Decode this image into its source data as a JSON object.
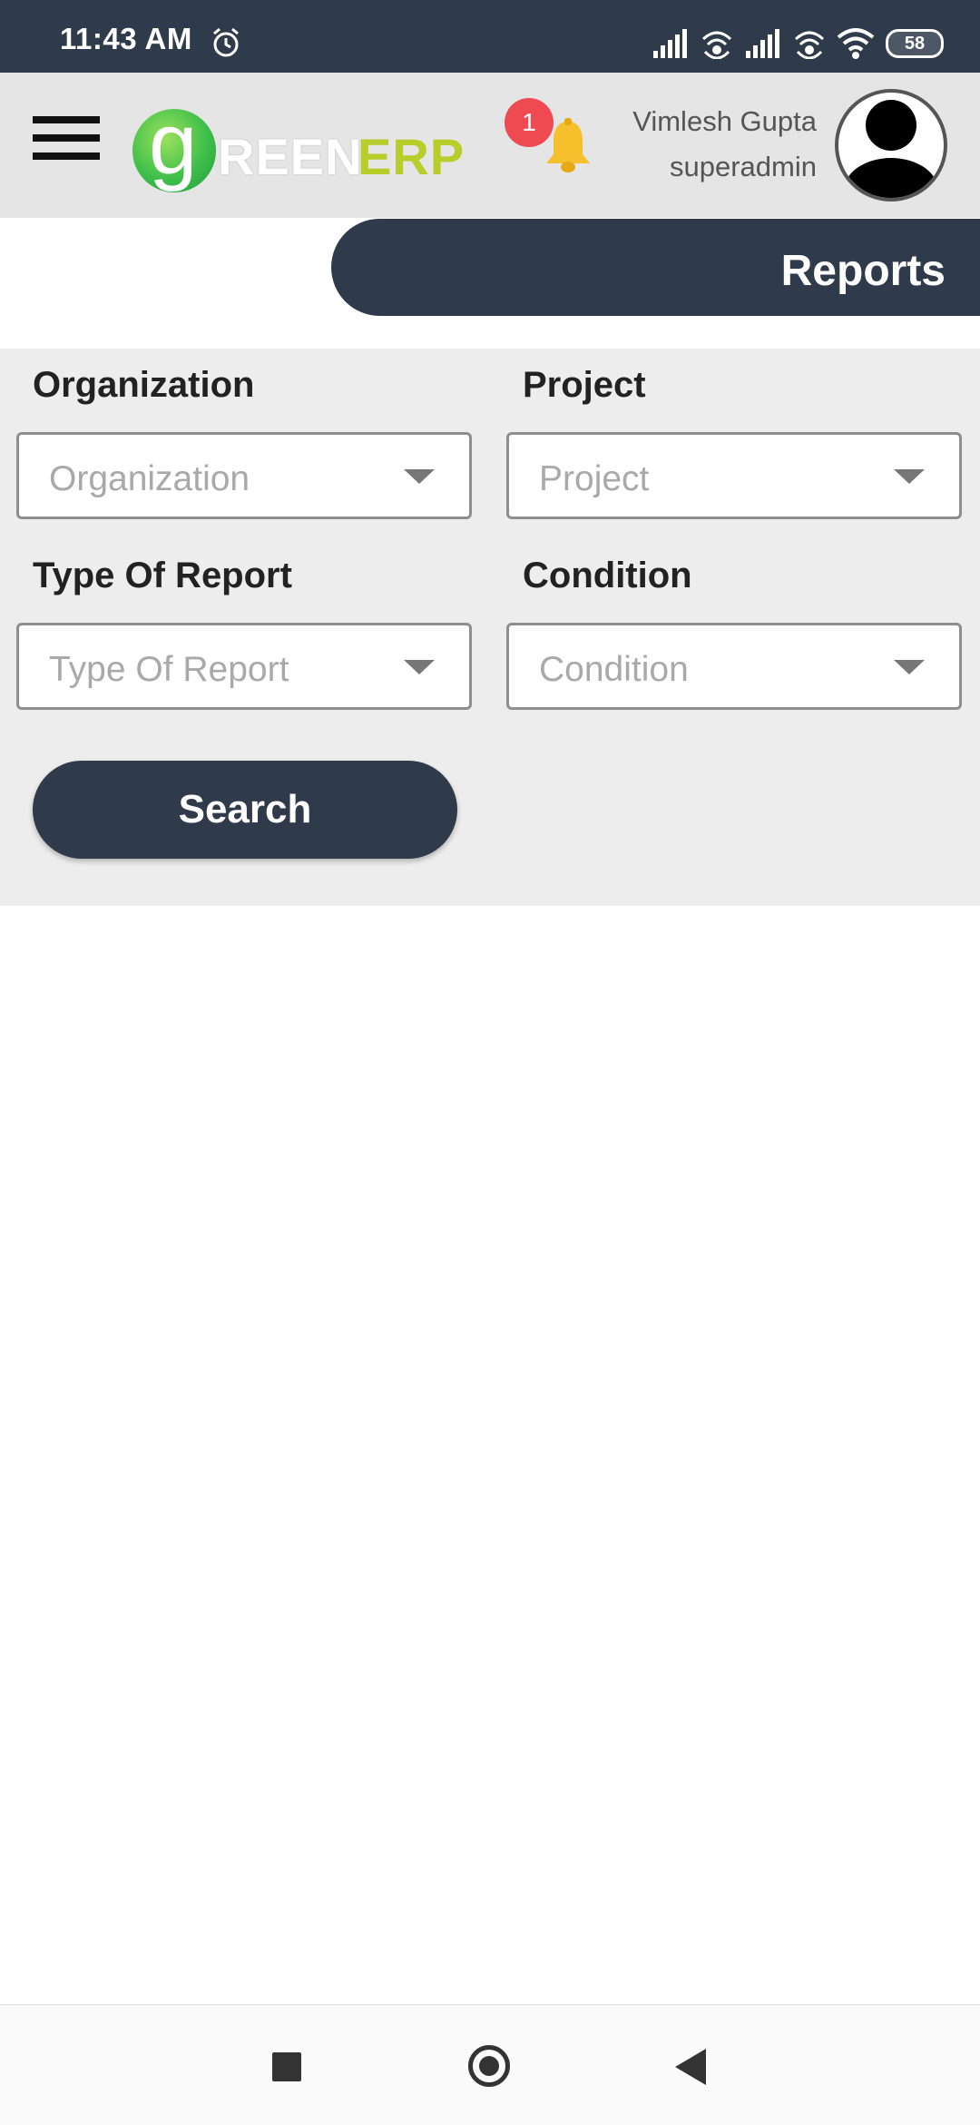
{
  "status_bar": {
    "time": "11:43 AM",
    "battery": "58",
    "icons": [
      "alarm-icon",
      "signal-icon",
      "hotspot-icon",
      "signal-icon",
      "hotspot-icon",
      "wifi-icon",
      "battery-icon"
    ]
  },
  "header": {
    "logo_g": "g",
    "logo_reen": "REEN",
    "logo_erp": "ERP",
    "notification_count": "1",
    "user_name": "Vimlesh Gupta",
    "user_role": "superadmin"
  },
  "page": {
    "title": "Reports"
  },
  "filters": {
    "organization": {
      "label": "Organization",
      "placeholder": "Organization"
    },
    "project": {
      "label": "Project",
      "placeholder": "Project"
    },
    "type_of_report": {
      "label": "Type Of Report",
      "placeholder": "Type Of Report"
    },
    "condition": {
      "label": "Condition",
      "placeholder": "Condition"
    },
    "search_label": "Search"
  },
  "colors": {
    "dark_navy": "#2f3a4b",
    "panel_gray": "#ededed",
    "header_gray": "#e5e5e5",
    "badge_red": "#ef4a51",
    "logo_green": "#3fbf4a",
    "logo_erp": "#b8cc2a"
  }
}
